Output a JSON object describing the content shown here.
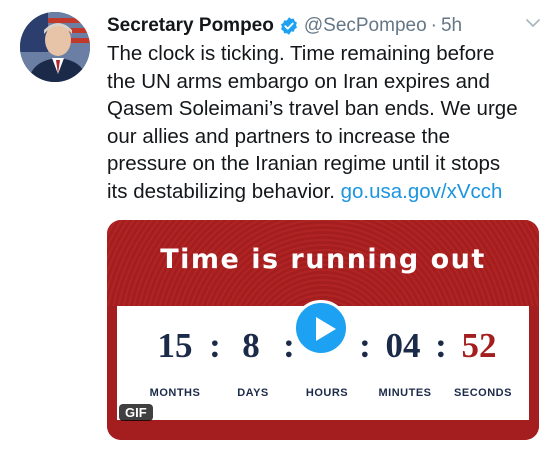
{
  "tweet": {
    "author_name": "Secretary Pompeo",
    "handle": "@SecPompeo",
    "separator": "·",
    "time": "5h",
    "text_lines": [
      "The clock is ticking. Time remaining before",
      "the UN arms embargo on Iran expires and",
      "Qasem Soleimani’s travel ban ends. We urge",
      "our allies and partners to increase the",
      "pressure on the Iranian regime until it stops"
    ],
    "last_line_text": "its destabilizing behavior. ",
    "link_text": "go.usa.gov/xVcch"
  },
  "media": {
    "title": "Time is running out",
    "countdown": {
      "months": "15",
      "days": "8",
      "hours": "",
      "minutes": "04",
      "seconds": "52",
      "separator": ":"
    },
    "labels": {
      "months": "MONTHS",
      "days": "DAYS",
      "hours": "HOURS",
      "minutes": "MINUTES",
      "seconds": "SECONDS"
    },
    "badge": "GIF"
  },
  "colors": {
    "verified": "#1da1f2",
    "link": "#1b95e0",
    "banner_red": "#a51e1f",
    "counter_navy": "#1c2a4a"
  },
  "icons": [
    "verified-badge-icon",
    "chevron-down-icon",
    "play-icon"
  ]
}
